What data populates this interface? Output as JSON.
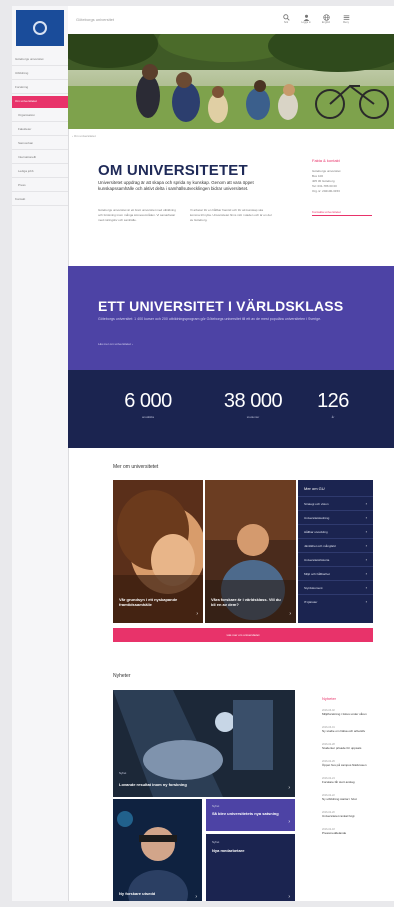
{
  "topbar": {
    "site_name": "Göteborgs universitet",
    "tools": [
      {
        "icon": "search-icon",
        "label": "Sök"
      },
      {
        "icon": "user-icon",
        "label": "Logga in"
      },
      {
        "icon": "globe-icon",
        "label": "English"
      },
      {
        "icon": "menu-icon",
        "label": "Meny"
      }
    ]
  },
  "sidebar": {
    "items": [
      {
        "label": "Göteborgs universitet",
        "active": false,
        "sub": false
      },
      {
        "label": "Utbildning",
        "active": false,
        "sub": false
      },
      {
        "label": "Forskning",
        "active": false,
        "sub": false
      },
      {
        "label": "Om universitetet",
        "active": true,
        "sub": false
      },
      {
        "label": "Organisation",
        "active": false,
        "sub": true
      },
      {
        "label": "Fakulteter",
        "active": false,
        "sub": true
      },
      {
        "label": "Samverkan",
        "active": false,
        "sub": true
      },
      {
        "label": "Internationellt",
        "active": false,
        "sub": true
      },
      {
        "label": "Lediga jobb",
        "active": false,
        "sub": true
      },
      {
        "label": "Press",
        "active": false,
        "sub": true
      },
      {
        "label": "Kontakt",
        "active": false,
        "sub": false
      }
    ]
  },
  "breadcrumb": "Om universitetet",
  "about": {
    "title": "OM UNIVERSITETET",
    "lead": "Universitetet uppdrag är att skapa och sprida ny kunskap. Genom att vara öppet kunskapssamhälle och aktivt delta i samhällsutvecklingen bidrar universitetet.",
    "col1": "Göteborgs universitet är ett brett universitet med utbildning och forskning inom många ämnesområden. Vi samarbetar med näringsliv och samhälle.",
    "col2": "Vi arbetar för en hållbar framtid och för att kunskap ska komma till nytta. Universitetet finns mitt i staden och är en del av Göteborg.",
    "facts_title": "Fakta & kontakt",
    "facts_lines": [
      "Göteborgs universitet",
      "Box 100",
      "405 30 Göteborg",
      "Tel: 031-786 00 00",
      "Org.nr: 202100-3153"
    ],
    "facts_link": "Kontakta universitetet"
  },
  "band": {
    "title": "ETT UNIVERSITET I VÄRLDSKLASS",
    "text": "Göteborgs universitet: 1 400 kurser och 200 utbildningsprogram gör Göteborgs universitet till ett av de mest populära universiteten i Sverige.",
    "link": "Läs mer om universitetet"
  },
  "stats": [
    {
      "value": "6 000",
      "label": "anställda"
    },
    {
      "value": "38 000",
      "label": "studenter"
    },
    {
      "value": "126",
      "label": "år"
    }
  ],
  "cards_section": {
    "title": "Mer om universitetet",
    "cards": [
      {
        "caption": "Vår grundsyn i ett nyskapande framtidssamhälle"
      },
      {
        "caption": "Våra forskare är i världsklass. Vill du bli en av dem?"
      }
    ],
    "links_title": "Mer om GU",
    "links": [
      "Strategi och vision",
      "Universitetsledning",
      "Hållbar utveckling",
      "Jämlikhet och mångfald",
      "Universitetshistoria",
      "Miljö och hållbarhet",
      "Styrdokument",
      "IT-tjänster"
    ],
    "button": "Läs mer om universitetet"
  },
  "news_section": {
    "title": "Nyheter",
    "features": [
      {
        "tag": "Nyhet",
        "title": "Lovande resultat inom ny forskning"
      },
      {
        "tag": "Nyhet",
        "title": "Så blev universitetets nya satsning"
      },
      {
        "tag": "Nyhet",
        "title": "Ny forskare utsedd"
      },
      {
        "tag": "Nyhet",
        "title": "Nya medarbetare"
      }
    ],
    "side_title": "Nyheter",
    "side_items": [
      {
        "date": "2016-03-02",
        "title": "Miljöforskning i fokus under våren"
      },
      {
        "date": "2016-03-01",
        "title": "Ny studie om hälsa och arbetsliv"
      },
      {
        "date": "2016-02-28",
        "title": "Studenter prisade för uppsats"
      },
      {
        "date": "2016-02-26",
        "title": "Öppet hus på campus Näckrosen"
      },
      {
        "date": "2016-02-24",
        "title": "Forskare får stort anslag"
      },
      {
        "date": "2016-02-22",
        "title": "Ny utbildning startar i höst"
      },
      {
        "date": "2016-02-20",
        "title": "Universitetet rankat högt"
      },
      {
        "date": "2016-02-18",
        "title": "Pressmeddelande"
      }
    ]
  },
  "colors": {
    "accent": "#e8336a",
    "purple": "#4d43a5",
    "navy": "#1b2450",
    "brand": "#1a4c9a"
  }
}
